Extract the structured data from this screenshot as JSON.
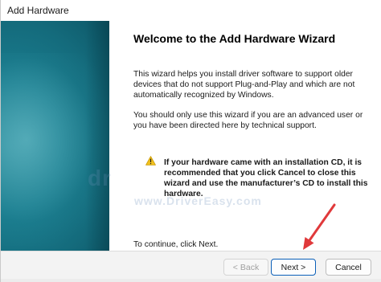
{
  "window": {
    "title": "Add Hardware"
  },
  "wizard": {
    "heading": "Welcome to the Add Hardware Wizard",
    "paragraph1": "This wizard helps you install driver software to support older devices that do not support Plug-and-Play and which are not automatically recognized by Windows.",
    "paragraph2": "You should only use this wizard if you are an advanced user or you have been directed here by technical support.",
    "warning": "If your hardware came with an installation CD, it is recommended that you click Cancel to close this wizard and use the manufacturer’s CD to install this hardware.",
    "continue_text": "To continue, click Next."
  },
  "watermark": {
    "logo": "dr",
    "url": "www.DriverEasy.com"
  },
  "buttons": {
    "back": "< Back",
    "next": "Next >",
    "cancel": "Cancel"
  },
  "icons": {
    "warning": "warning-triangle-icon"
  },
  "colors": {
    "side_panel": "#1a7d8f",
    "annotation_arrow": "#e0393b",
    "default_button_border": "#0a5fb8"
  }
}
